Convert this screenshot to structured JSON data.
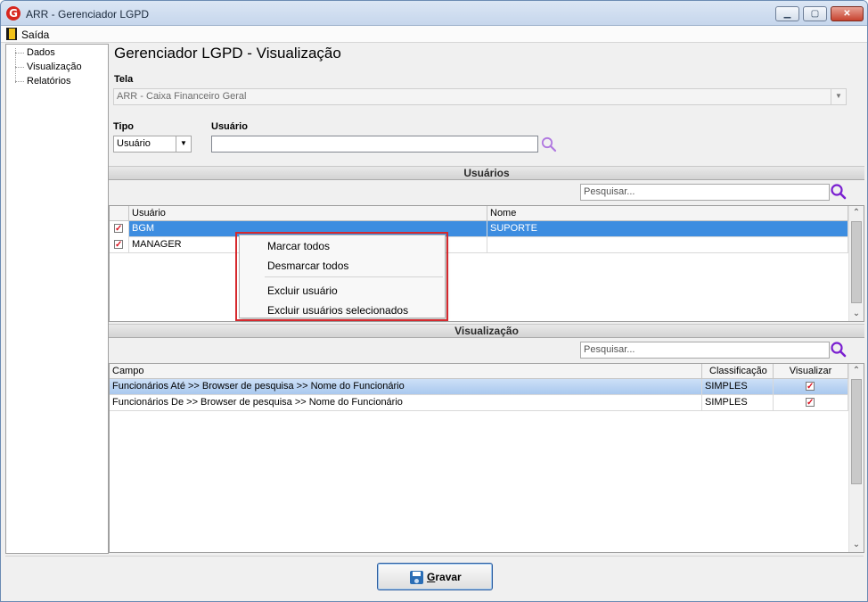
{
  "window": {
    "title": "ARR - Gerenciador LGPD",
    "app_icon_glyph": "G",
    "brand_color": "#d7261e"
  },
  "menu": {
    "exit_label": "Saída"
  },
  "tree": {
    "items": [
      "Dados",
      "Visualização",
      "Relatórios"
    ]
  },
  "page": {
    "heading": "Gerenciador LGPD - Visualização"
  },
  "tela": {
    "label": "Tela",
    "value": "ARR - Caixa Financeiro Geral"
  },
  "tipo": {
    "label": "Tipo",
    "value": "Usuário"
  },
  "usuario": {
    "label": "Usuário",
    "value": ""
  },
  "usuarios_section": {
    "title": "Usuários",
    "search_placeholder": "Pesquisar...",
    "columns": [
      "Usuário",
      "Nome"
    ],
    "rows": [
      {
        "checked": true,
        "usuario": "BGM",
        "nome": "SUPORTE",
        "selected": true
      },
      {
        "checked": true,
        "usuario": "MANAGER",
        "nome": "",
        "selected": false
      }
    ]
  },
  "context_menu": {
    "items": [
      "Marcar todos",
      "Desmarcar todos",
      "Excluir usuário",
      "Excluir usuários selecionados"
    ],
    "highlight_color": "#d6292e"
  },
  "visualizacao_section": {
    "title": "Visualização",
    "search_placeholder": "Pesquisar...",
    "columns": [
      "Campo",
      "Classificação",
      "Visualizar"
    ],
    "rows": [
      {
        "campo": "Funcionários Até >> Browser de pesquisa >> Nome do Funcionário",
        "classificacao": "SIMPLES",
        "visualizar": true,
        "selected": true
      },
      {
        "campo": "Funcionários De >> Browser de pesquisa >> Nome do Funcionário",
        "classificacao": "SIMPLES",
        "visualizar": true,
        "selected": false
      }
    ]
  },
  "footer": {
    "save_label": "Gravar"
  },
  "icons": {
    "search": "magnifier-icon",
    "save": "floppy-icon",
    "exit": "door-exit-icon",
    "check": "checkmark"
  },
  "colors": {
    "selection": "#3d8de0",
    "search_icon": "#8b3fd9",
    "check": "#d9101e"
  }
}
